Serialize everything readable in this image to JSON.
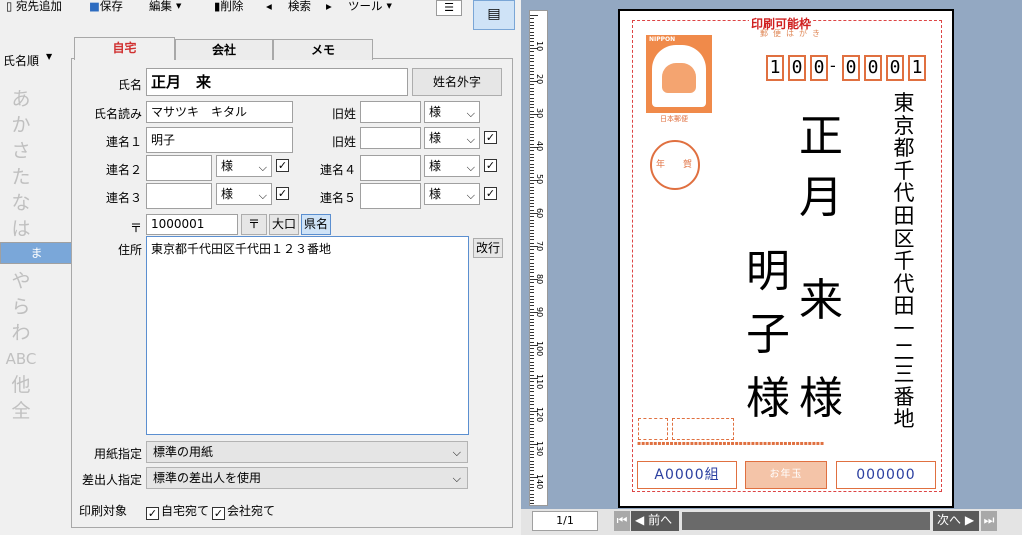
{
  "toolbar": {
    "add_recipient": "宛先追加",
    "save": "保存",
    "edit": "編集",
    "delete": "削除",
    "search": "検索",
    "tools": "ツール"
  },
  "sort": {
    "label": "氏名順"
  },
  "index": [
    "あ",
    "か",
    "さ",
    "た",
    "な",
    "は",
    "ま",
    "や",
    "ら",
    "わ",
    "ABC",
    "他",
    "全"
  ],
  "tabs": [
    "自宅",
    "会社",
    "メモ"
  ],
  "form": {
    "name_label": "氏名",
    "name_value": "正月　来",
    "gaiji_button": "姓名外字",
    "reading_label": "氏名読み",
    "reading_value": "マサツキ　キタル",
    "old_surname_label": "旧姓",
    "honorific": "様",
    "joint1_label": "連名１",
    "joint1_value": "明子",
    "joint2_label": "連名２",
    "joint3_label": "連名３",
    "joint4_label": "連名４",
    "joint5_label": "連名５",
    "zip_label": "〒",
    "zip_value": "1000001",
    "zip_button": "〒",
    "large_button": "大口",
    "pref_button": "県名",
    "address_label": "住所",
    "address_value": "東京都千代田区千代田１２３番地",
    "newline_button": "改行",
    "paper_label": "用紙指定",
    "paper_value": "標準の用紙",
    "sender_label": "差出人指定",
    "sender_value": "標準の差出人を使用",
    "print_target_label": "印刷対象",
    "print_home": "自宅宛て",
    "print_company": "会社宛て",
    "check_mark": "✓"
  },
  "preview": {
    "print_area": "印刷可能枠",
    "postcard_text": "郵便はがき",
    "stamp_brand": "NIPPON",
    "stamp_caption": "日本郵便",
    "stamp_year": "年賀",
    "zip_digits": [
      "1",
      "0",
      "0",
      "0",
      "0",
      "0",
      "1"
    ],
    "zip_dash": "-",
    "recipient_surname": [
      "正",
      "月"
    ],
    "recipient_given": "来",
    "honorific1": "様",
    "joint_name": [
      "明",
      "子"
    ],
    "honorific2": "様",
    "address_vertical": "東京都千代田区千代田一二三番地",
    "lottery_left": "A0000組",
    "lottery_mid": "お年玉",
    "lottery_right": "000000",
    "page": "1/1",
    "prev": "前へ",
    "next": "次へ",
    "ruler": [
      "10",
      "20",
      "30",
      "40",
      "50",
      "60",
      "70",
      "80",
      "90",
      "100",
      "110",
      "120",
      "130",
      "140"
    ]
  }
}
